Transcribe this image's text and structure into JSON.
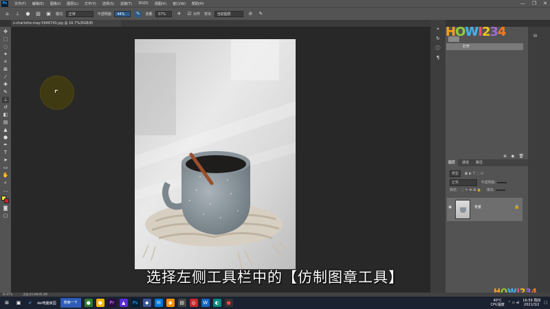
{
  "menubar": {
    "logo": "Ps",
    "items": [
      "文件(F)",
      "编辑(E)",
      "图像(I)",
      "图层(L)",
      "文字(Y)",
      "选择(S)",
      "滤镜(T)",
      "3D(D)",
      "视图(V)",
      "窗口(W)",
      "帮助(H)"
    ],
    "win_minimize": "—",
    "win_restore": "❐",
    "win_close": "✕"
  },
  "options": {
    "mode_label": "模式:",
    "mode_value": "正常",
    "opacity_label": "不透明度:",
    "opacity_value": "44%",
    "flow_label": "流量:",
    "flow_value": "57%",
    "aligned_label": "对齐",
    "sample_label": "样本:",
    "sample_value": "当前图层"
  },
  "document": {
    "tab_title": "s-charlotte-may-5946743.jpg @ 16.7%(RGB/8)"
  },
  "panels": {
    "history_item": "打开",
    "layers_tabs": [
      "图层",
      "通道",
      "路径"
    ],
    "layers_kind": "类型",
    "layers_blend": "正常",
    "layers_opacity_label": "不透明度:",
    "layers_lock_label": "锁定:",
    "layers_fill_label": "填充:",
    "layer_name": "背景"
  },
  "status": {
    "zoom": "16.67%",
    "doc": "文档:45.4M/45.4M"
  },
  "caption": "选择左侧工具栏中的【仿制图章工具】",
  "logo_text": "HOWI234",
  "taskbar": {
    "app_label": "del电脑家园",
    "search_label": "搜索一下",
    "temp": "40°C",
    "cpu": "CPU温度",
    "time": "16:59 周四",
    "date": "2021/3/2"
  },
  "colors": {
    "accent": "#2b5a8a",
    "panel": "#535353",
    "canvas": "#282828"
  }
}
